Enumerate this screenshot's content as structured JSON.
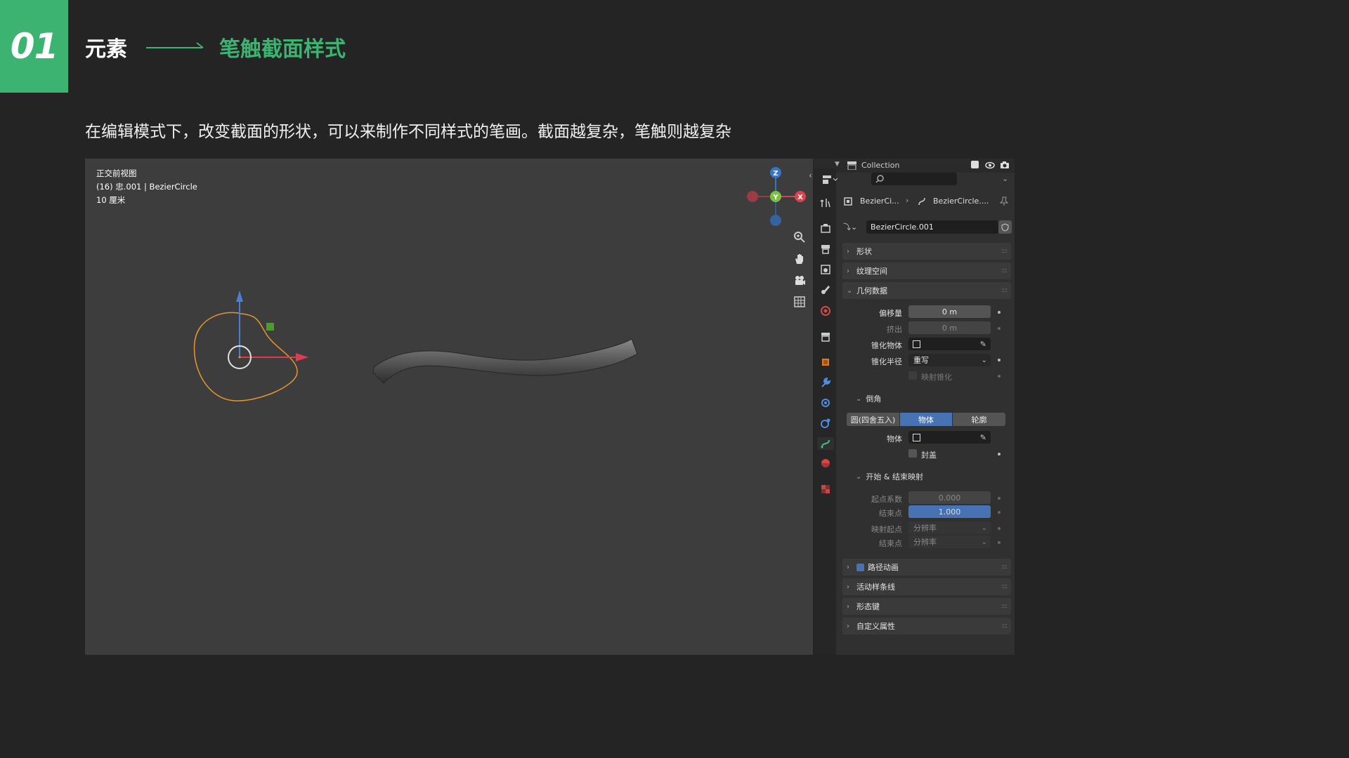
{
  "slide": {
    "number": "01",
    "title_main": "元素",
    "title_sub": "笔触截面样式",
    "description": "在编辑模式下，改变截面的形状，可以来制作不同样式的笔画。截面越复杂，笔触则越复杂"
  },
  "viewport": {
    "view_name": "正交前视图",
    "object_info": "(16) 忠.001 | BezierCircle",
    "scale": "10 厘米",
    "gizmo": {
      "z": "Z",
      "y": "Y",
      "x": "X"
    }
  },
  "outliner": {
    "collection": "Collection"
  },
  "properties": {
    "breadcrumb_object": "BezierCi...",
    "breadcrumb_data": "BezierCircle....",
    "datablock_name": "BezierCircle.001",
    "sections": {
      "shape": "形状",
      "texture_space": "纹理空间",
      "geometry": "几何数据",
      "bevel": "倒角",
      "start_end": "开始 & 结束映射",
      "path_animation": "路径动画",
      "active_spline": "活动样条线",
      "shape_keys": "形态键",
      "custom_props": "自定义属性"
    },
    "geometry": {
      "offset_label": "偏移量",
      "offset_value": "0 m",
      "extrude_label": "挤出",
      "extrude_value": "0 m",
      "taper_label": "锥化物体",
      "taper_radius_label": "锥化半径",
      "taper_radius_value": "重写",
      "map_taper_label": "映射锥化"
    },
    "bevel": {
      "modes": [
        "圆(四舍五入)",
        "物体",
        "轮廓"
      ],
      "active_mode": "物体",
      "object_label": "物体",
      "fill_caps_label": "封盖"
    },
    "start_end": {
      "start_factor_label": "起点系数",
      "start_factor_value": "0.000",
      "end_label": "结束点",
      "end_value": "1.000",
      "map_start_label": "映射起点",
      "map_start_value": "分辨率",
      "map_end_label": "结束点",
      "map_end_value": "分辨率"
    }
  },
  "colors": {
    "accent_green": "#3cb371",
    "blender_blue": "#4772b3",
    "curve_orange": "#e8952e"
  }
}
